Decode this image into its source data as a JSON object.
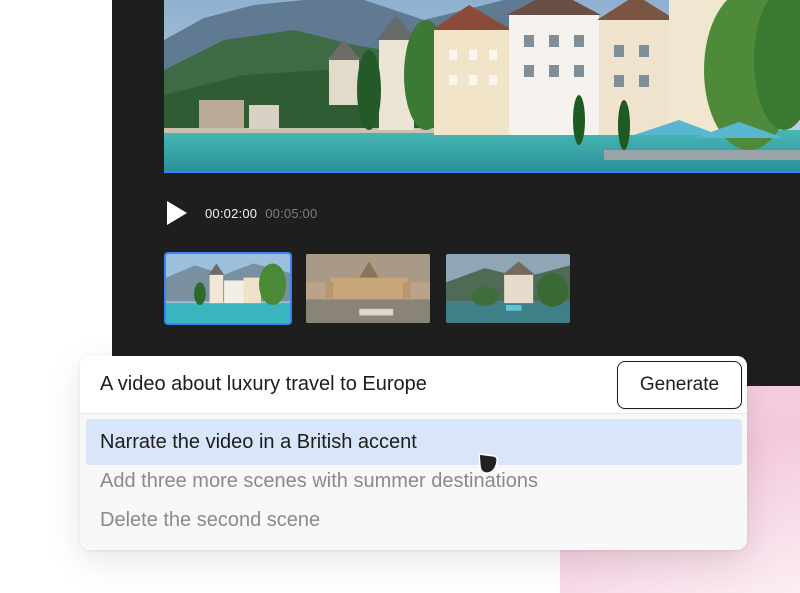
{
  "player": {
    "current_time": "00:02:00",
    "total_time": "00:05:00",
    "play_icon": "play-icon"
  },
  "scenes": [
    {
      "label": "scene-1",
      "selected": true
    },
    {
      "label": "scene-2",
      "selected": false
    },
    {
      "label": "scene-3",
      "selected": false
    }
  ],
  "prompt": {
    "text": "A video about luxury travel to Europe",
    "generate_label": "Generate"
  },
  "suggestions": [
    "Narrate the video in a British accent",
    "Add three more scenes with summer destinations",
    "Delete the second scene"
  ],
  "colors": {
    "editor_bg": "#1e1e1e",
    "accent": "#3b82f6",
    "highlight": "#d9e6f9"
  }
}
